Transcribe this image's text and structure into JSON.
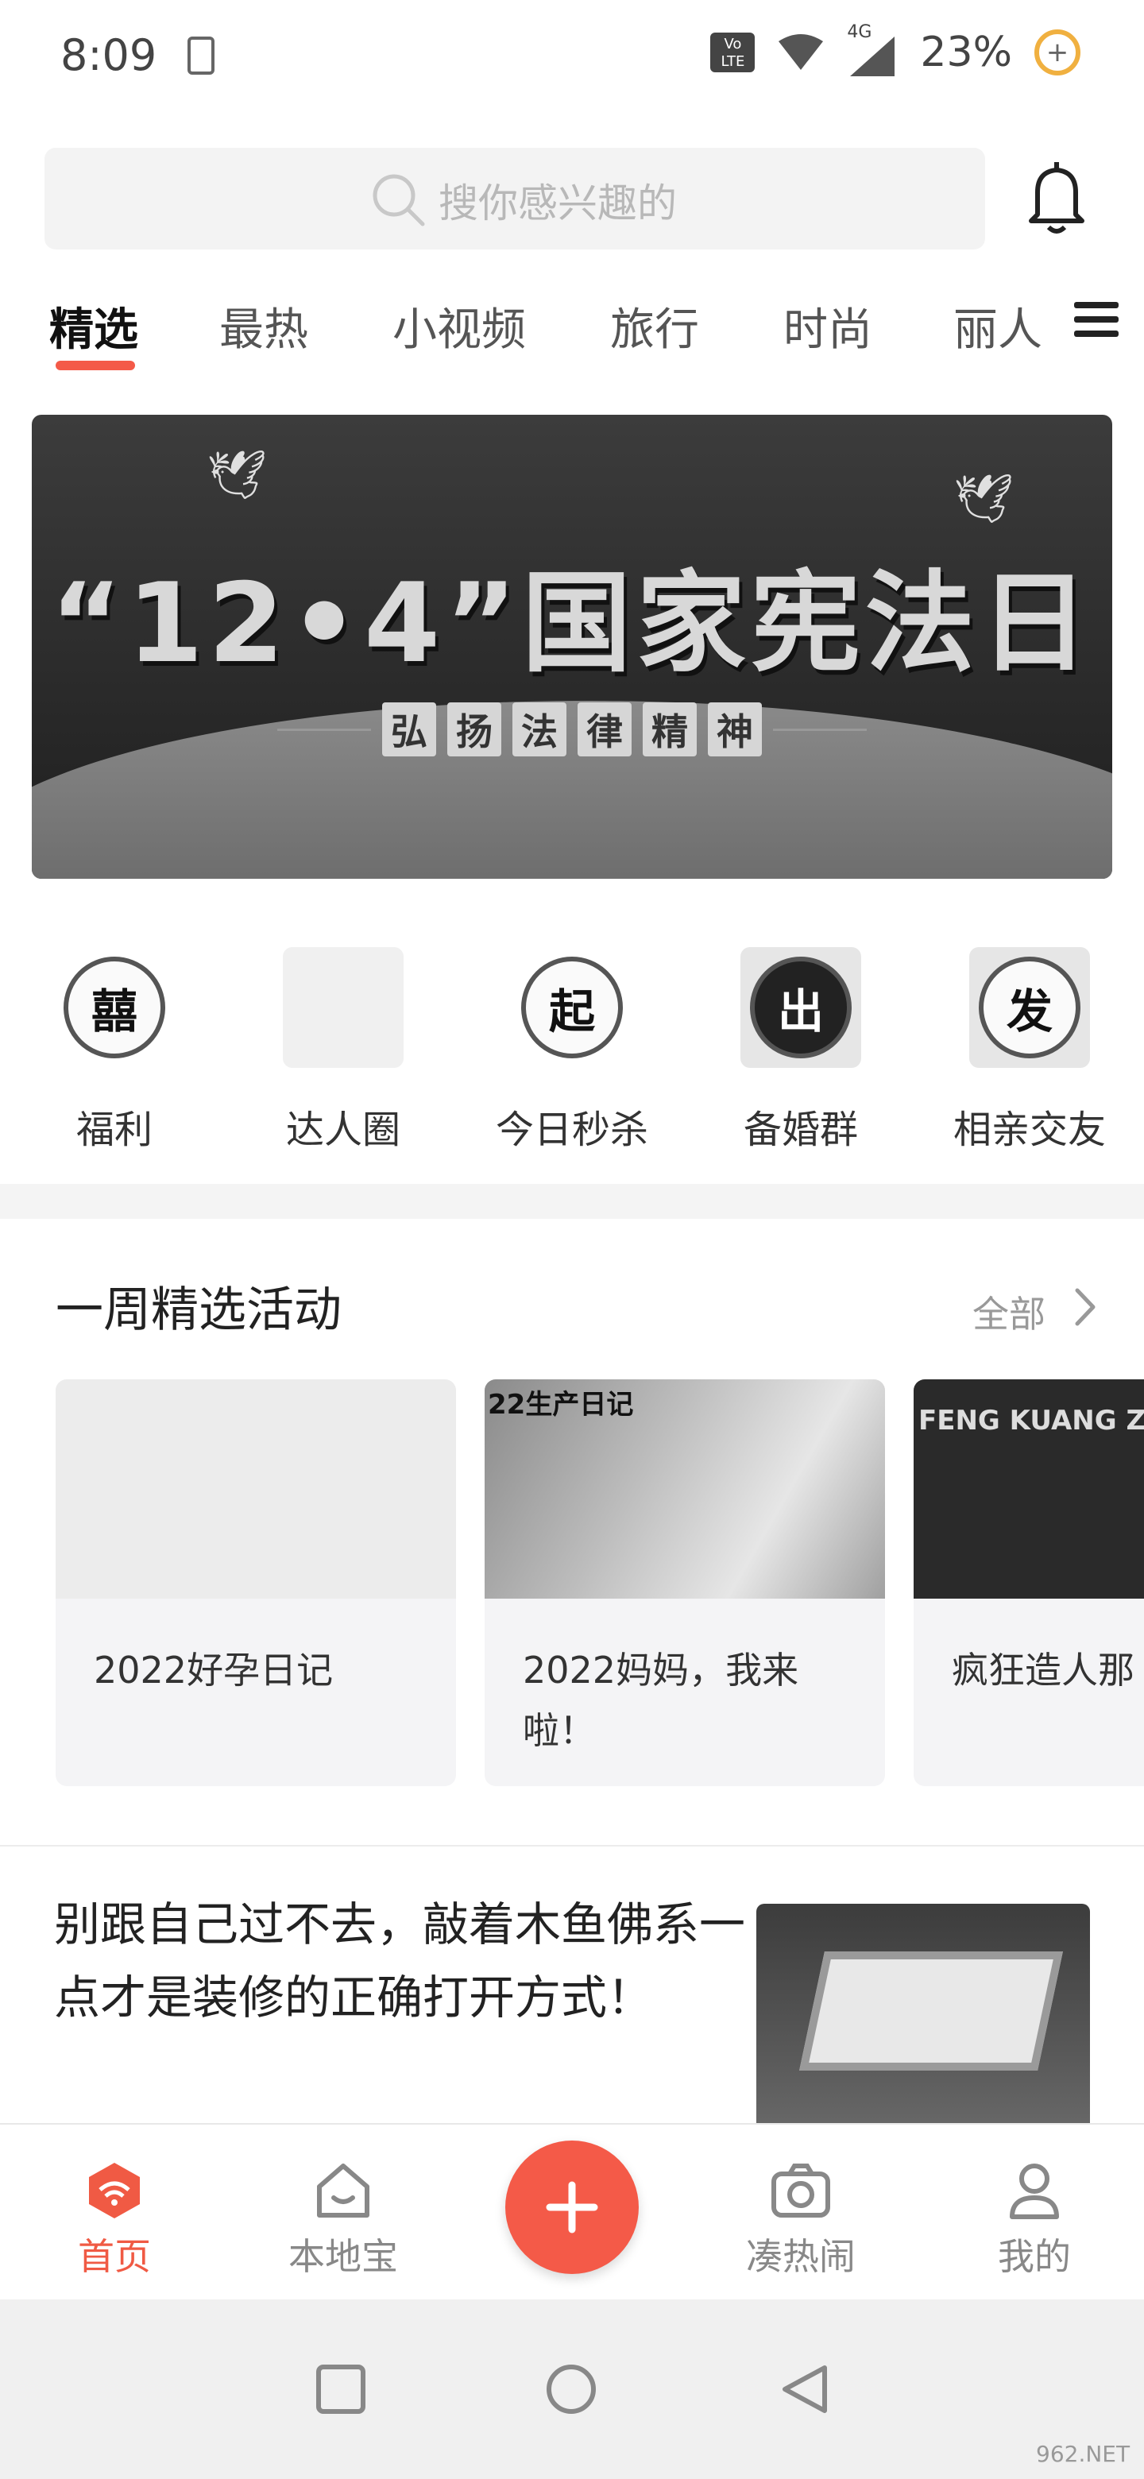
{
  "status_bar": {
    "time": "8:09",
    "battery": "23%",
    "network": "4G",
    "volte": "Vo LTE"
  },
  "search": {
    "placeholder": "搜你感兴趣的"
  },
  "tabs": [
    "精选",
    "最热",
    "小视频",
    "旅行",
    "时尚",
    "丽人"
  ],
  "banner": {
    "headline": "“12•4”国家宪法日",
    "subtitle_chars": [
      "弘",
      "扬",
      "法",
      "律",
      "精",
      "神"
    ]
  },
  "shortcuts": [
    {
      "label": "福利",
      "icon_char": "囍"
    },
    {
      "label": "达人圈",
      "icon_char": ""
    },
    {
      "label": "今日秒杀",
      "icon_char": "起"
    },
    {
      "label": "备婚群",
      "icon_char": "出"
    },
    {
      "label": "相亲交友",
      "icon_char": "发"
    }
  ],
  "activities": {
    "title": "一周精选活动",
    "more": "全部",
    "cards": [
      {
        "title": "2022好孕日记",
        "image_text": ""
      },
      {
        "title": "2022妈妈，我来啦！",
        "image_text": "22生产日记"
      },
      {
        "title": "疯狂造人那",
        "image_text": "FENG KUANG ZAO"
      }
    ]
  },
  "article": {
    "title": "别跟自己过不去，敲着木鱼佛系一点才是装修的正确打开方式！"
  },
  "bottom_nav": [
    {
      "label": "首页",
      "icon": "home-icon",
      "active": true
    },
    {
      "label": "本地宝",
      "icon": "house-icon",
      "active": false
    },
    {
      "label": "凑热闹",
      "icon": "camera-icon",
      "active": false
    },
    {
      "label": "我的",
      "icon": "person-icon",
      "active": false
    }
  ],
  "watermark": "962.NET",
  "colors": {
    "accent": "#f45a48",
    "text": "#222222",
    "muted": "#999999"
  }
}
